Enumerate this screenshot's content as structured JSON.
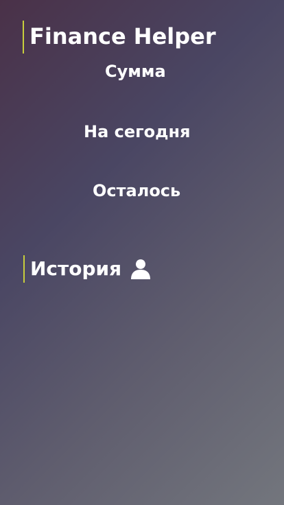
{
  "app": {
    "title": "Finance Helper"
  },
  "stats": {
    "sum_label": "Сумма",
    "today_label": "На сегодня",
    "left_label": "Осталось"
  },
  "history": {
    "label": "История",
    "icon": "user-icon"
  },
  "colors": {
    "accent": "#c9cf3c",
    "text": "#ffffff"
  }
}
